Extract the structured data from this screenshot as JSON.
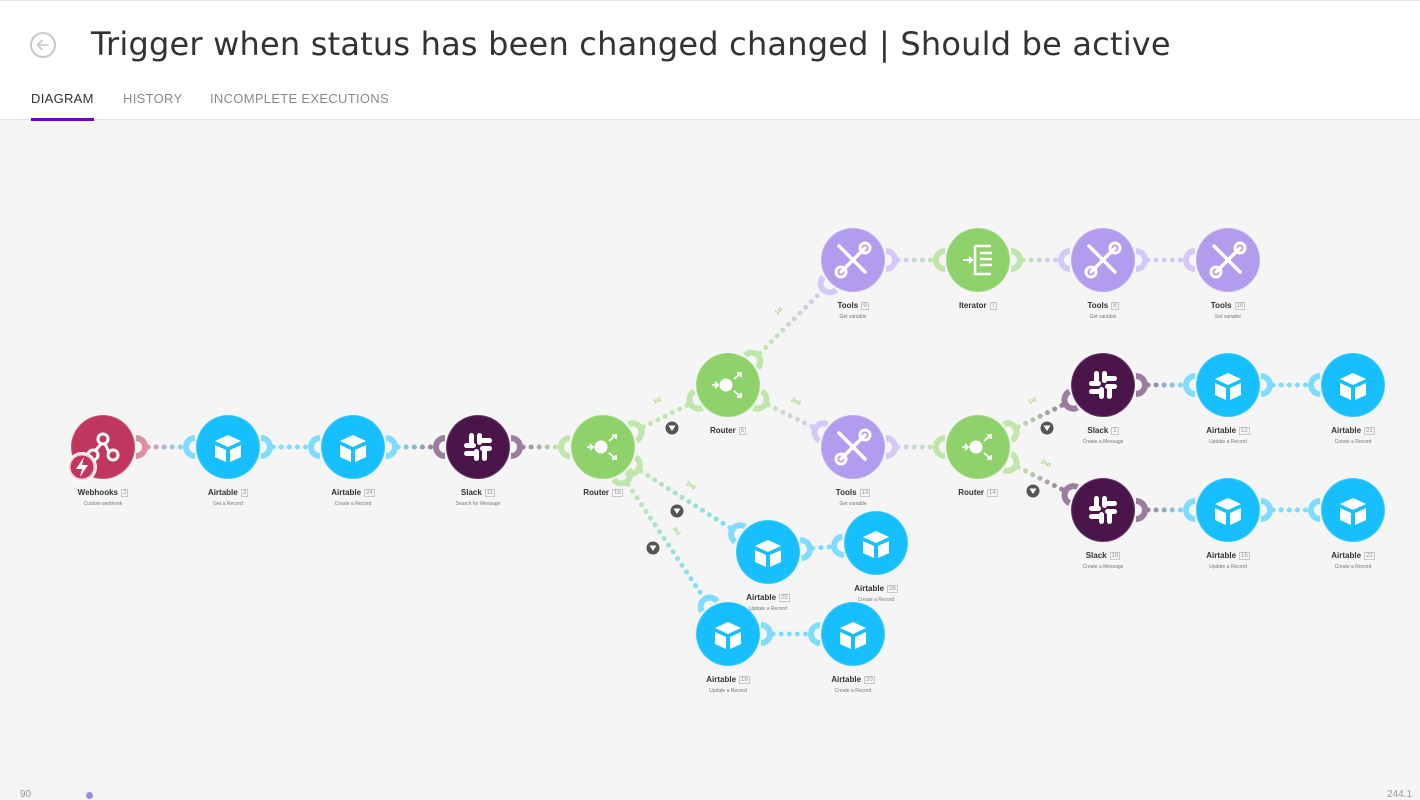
{
  "header": {
    "title": "Trigger when status has been changed changed | Should be active",
    "tabs": [
      {
        "label": "DIAGRAM",
        "active": true
      },
      {
        "label": "HISTORY",
        "active": false
      },
      {
        "label": "INCOMPLETE EXECUTIONS",
        "active": false
      }
    ]
  },
  "colors": {
    "webhooks": "#c0365e",
    "airtable": "#18bfff",
    "slack": "#4a154b",
    "router": "#8fd16a",
    "tools": "#b19cee",
    "iterator": "#8fd16a",
    "tab_accent": "#6d00cc"
  },
  "nodes": [
    {
      "id": "webhooks",
      "app": "Webhooks",
      "num": "2",
      "sub": "Custom webhook",
      "icon": "webhook-icon"
    },
    {
      "id": "airtable-3",
      "app": "Airtable",
      "num": "3",
      "sub": "Get a Record",
      "icon": "airtable-icon"
    },
    {
      "id": "airtable-24",
      "app": "Airtable",
      "num": "24",
      "sub": "Create a Record",
      "icon": "airtable-icon"
    },
    {
      "id": "slack-11",
      "app": "Slack",
      "num": "11",
      "sub": "Search for Message",
      "icon": "slack-icon"
    },
    {
      "id": "router-16",
      "app": "Router",
      "num": "16",
      "sub": "",
      "icon": "router-icon"
    },
    {
      "id": "router-5",
      "app": "Router",
      "num": "5",
      "sub": "",
      "icon": "router-icon"
    },
    {
      "id": "tools-9",
      "app": "Tools",
      "num": "9",
      "sub": "Get variable",
      "icon": "tools-icon"
    },
    {
      "id": "iterator-7",
      "app": "Iterator",
      "num": "7",
      "sub": "",
      "icon": "iterator-icon"
    },
    {
      "id": "tools-8",
      "app": "Tools",
      "num": "8",
      "sub": "Get variable",
      "icon": "tools-icon"
    },
    {
      "id": "tools-10",
      "app": "Tools",
      "num": "10",
      "sub": "Set variable",
      "icon": "tools-icon"
    },
    {
      "id": "tools-13",
      "app": "Tools",
      "num": "13",
      "sub": "Get variable",
      "icon": "tools-icon"
    },
    {
      "id": "router-14",
      "app": "Router",
      "num": "14",
      "sub": "",
      "icon": "router-icon"
    },
    {
      "id": "slack-1",
      "app": "Slack",
      "num": "1",
      "sub": "Create a Message",
      "icon": "slack-icon"
    },
    {
      "id": "airtable-12",
      "app": "Airtable",
      "num": "12",
      "sub": "Update a Record",
      "icon": "airtable-icon"
    },
    {
      "id": "airtable-21",
      "app": "Airtable",
      "num": "21",
      "sub": "Create a Record",
      "icon": "airtable-icon"
    },
    {
      "id": "slack-18",
      "app": "Slack",
      "num": "18",
      "sub": "Create a Message",
      "icon": "slack-icon"
    },
    {
      "id": "airtable-15",
      "app": "Airtable",
      "num": "15",
      "sub": "Update a Record",
      "icon": "airtable-icon"
    },
    {
      "id": "airtable-22",
      "app": "Airtable",
      "num": "22",
      "sub": "Create a Record",
      "icon": "airtable-icon"
    },
    {
      "id": "airtable-25",
      "app": "Airtable",
      "num": "25",
      "sub": "Update a Record",
      "icon": "airtable-icon"
    },
    {
      "id": "airtable-26",
      "app": "Airtable",
      "num": "26",
      "sub": "Create a Record",
      "icon": "airtable-icon"
    },
    {
      "id": "airtable-19",
      "app": "Airtable",
      "num": "19",
      "sub": "Update a Record",
      "icon": "airtable-icon"
    },
    {
      "id": "airtable-20",
      "app": "Airtable",
      "num": "20",
      "sub": "Create a Record",
      "icon": "airtable-icon"
    }
  ],
  "route_labels": [
    "1st",
    "2nd",
    "3rd"
  ],
  "footer": {
    "left": "90",
    "right": "244.1"
  }
}
